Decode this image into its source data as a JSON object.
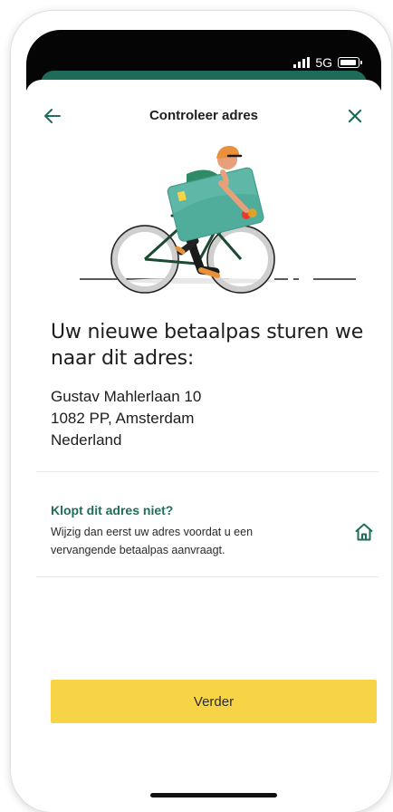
{
  "status": {
    "network": "5G"
  },
  "header": {
    "title": "Controleer adres"
  },
  "heading": "Uw nieuwe betaalpas sturen we naar dit adres:",
  "address": {
    "line1": "Gustav Mahlerlaan 10",
    "line2": "1082 PP, Amsterdam",
    "line3": "Nederland"
  },
  "notice": {
    "title": "Klopt dit adres niet?",
    "text": "Wijzig dan eerst uw adres voordat u een vervangende betaalpas aanvraagt."
  },
  "cta": {
    "label": "Verder"
  },
  "colors": {
    "primary": "#1f6e5b",
    "accent": "#f7d446",
    "text": "#1d1d1d"
  },
  "icons": {
    "back": "arrow-left-icon",
    "close": "close-icon",
    "home": "home-icon"
  }
}
